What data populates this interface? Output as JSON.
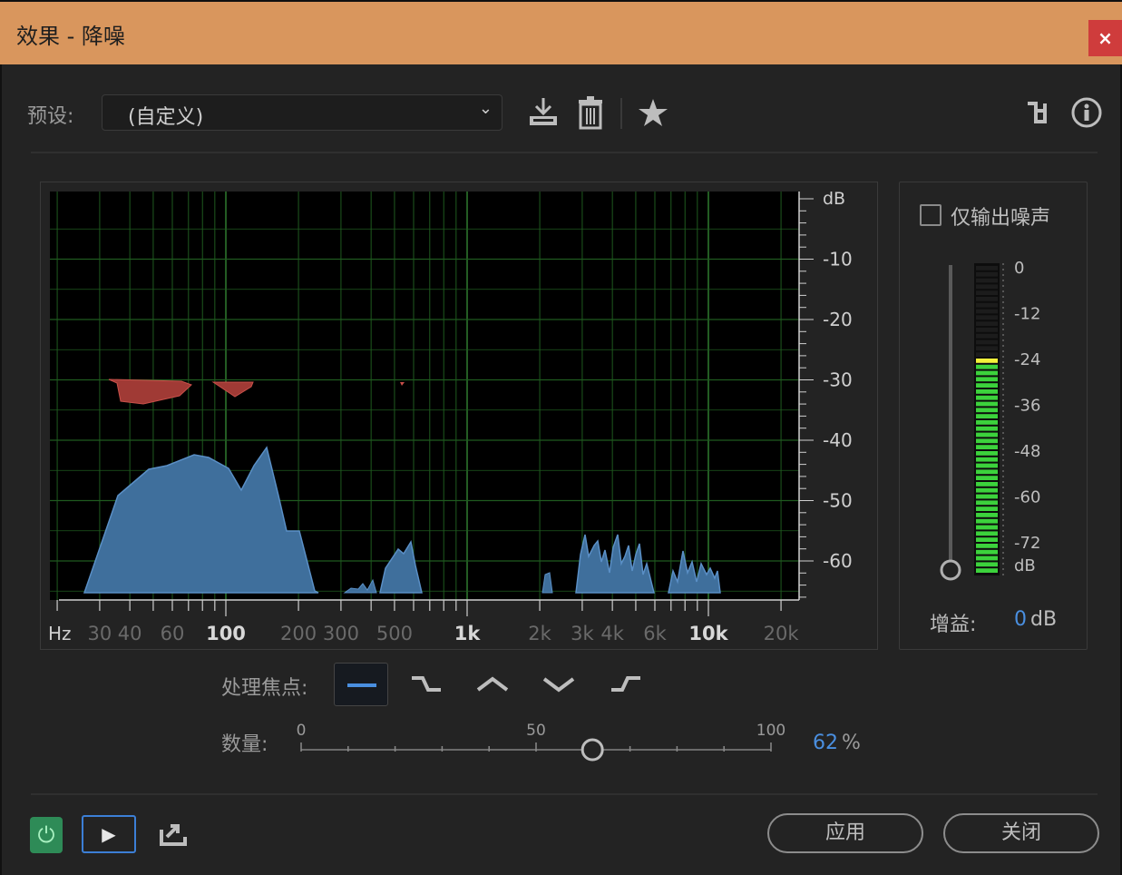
{
  "window": {
    "title": "效果 - 降噪",
    "close_label": "×"
  },
  "preset": {
    "label": "预设:",
    "value": "(自定义)"
  },
  "toolbar_icons": [
    "save-preset-icon",
    "delete-preset-icon",
    "favorite-star-icon",
    "routing-icon",
    "info-icon"
  ],
  "spectrum": {
    "db_unit": "dB",
    "db_ticks": [
      "-10",
      "-20",
      "-30",
      "-40",
      "-50",
      "-60"
    ],
    "freq_unit": "Hz",
    "freq_labels": [
      "30",
      "40",
      "60",
      "100",
      "200",
      "300",
      "500",
      "1k",
      "2k",
      "3k",
      "4k",
      "6k",
      "10k",
      "20k"
    ],
    "bold_freq_labels": [
      "100",
      "1k",
      "10k"
    ],
    "colors": {
      "noise": "#4f7fae",
      "threshold": "#b8433f",
      "grid": "#1f5a1f",
      "bg": "#000000"
    }
  },
  "output_noise_only": {
    "label": "仅输出噪声",
    "checked": false
  },
  "meter": {
    "ticks": [
      "0",
      "-12",
      "-24",
      "-36",
      "-48",
      "-60",
      "-72"
    ],
    "unit": "dB",
    "level_db": -24
  },
  "gain": {
    "label": "增益:",
    "value": "0",
    "unit": "dB",
    "value_color": "#4a8fe0"
  },
  "processing_focus": {
    "label": "处理焦点:",
    "options": [
      "focus-all-frequencies-icon",
      "focus-low-frequencies-icon",
      "focus-mid-frequencies-icon",
      "focus-low-high-frequencies-icon",
      "focus-high-frequencies-icon"
    ],
    "selected_index": 0
  },
  "amount": {
    "label": "数量:",
    "min_label": "0",
    "mid_label": "50",
    "max_label": "100",
    "value": "62",
    "unit": "%",
    "value_fraction": 0.62
  },
  "buttons": {
    "apply": "应用",
    "close": "关闭"
  },
  "footer_icons": [
    "power-icon",
    "play-icon",
    "export-icon"
  ]
}
